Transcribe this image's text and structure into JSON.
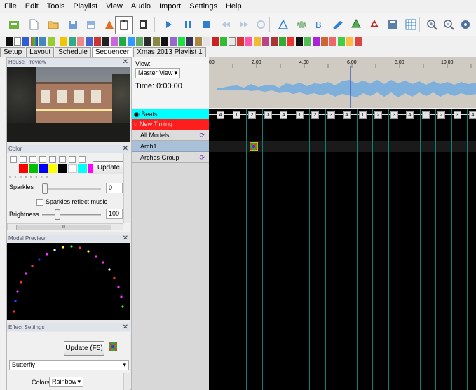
{
  "menu": [
    "File",
    "Edit",
    "Tools",
    "Playlist",
    "View",
    "Audio",
    "Import",
    "Settings",
    "Help"
  ],
  "tabs": [
    "Setup",
    "Layout",
    "Schedule",
    "Sequencer",
    "Xmas 2013 Playlist 1"
  ],
  "active_tab": "Sequencer",
  "house_preview": {
    "title": "House Preview"
  },
  "color_panel": {
    "title": "Color",
    "swatches": [
      "#ff0000",
      "#00c000",
      "#0000ff",
      "#ffff00",
      "#000000",
      "#ffffff",
      "#00ffff",
      "#ff00ff"
    ],
    "update_label": "Update",
    "sparkles_label": "Sparkles",
    "sparkles_value": "0",
    "sparkles_reflect_label": "Sparkles reflect music",
    "brightness_label": "Brightness",
    "brightness_value": "100",
    "scroll_marker": "III"
  },
  "model_preview": {
    "title": "Model Preview"
  },
  "effect_settings": {
    "title": "Effect Settings",
    "update_label": "Update (F5)",
    "effect": "Butterfly",
    "colors_label": "Colors",
    "colors_value": "Rainbow"
  },
  "view_panel": {
    "view_label": "View:",
    "view_select": "Master View",
    "time_label": "Time: 0:00.00"
  },
  "ruler": {
    "ticks": [
      "00",
      "2.00",
      "4.00",
      "6.00",
      "8.00",
      "10.00"
    ]
  },
  "rows": [
    {
      "label": "Beats",
      "kind": "timing"
    },
    {
      "label": "New Timing",
      "kind": "timing"
    },
    {
      "label": "All Models",
      "kind": "model"
    },
    {
      "label": "Arch1",
      "kind": "model"
    },
    {
      "label": "Arches Group",
      "kind": "model"
    }
  ],
  "beats": [
    "4",
    "1",
    "2",
    "3",
    "4",
    "1",
    "2",
    "3",
    "4",
    "1",
    "2",
    "3",
    "4",
    "1",
    "2",
    "3",
    "4",
    "1"
  ]
}
